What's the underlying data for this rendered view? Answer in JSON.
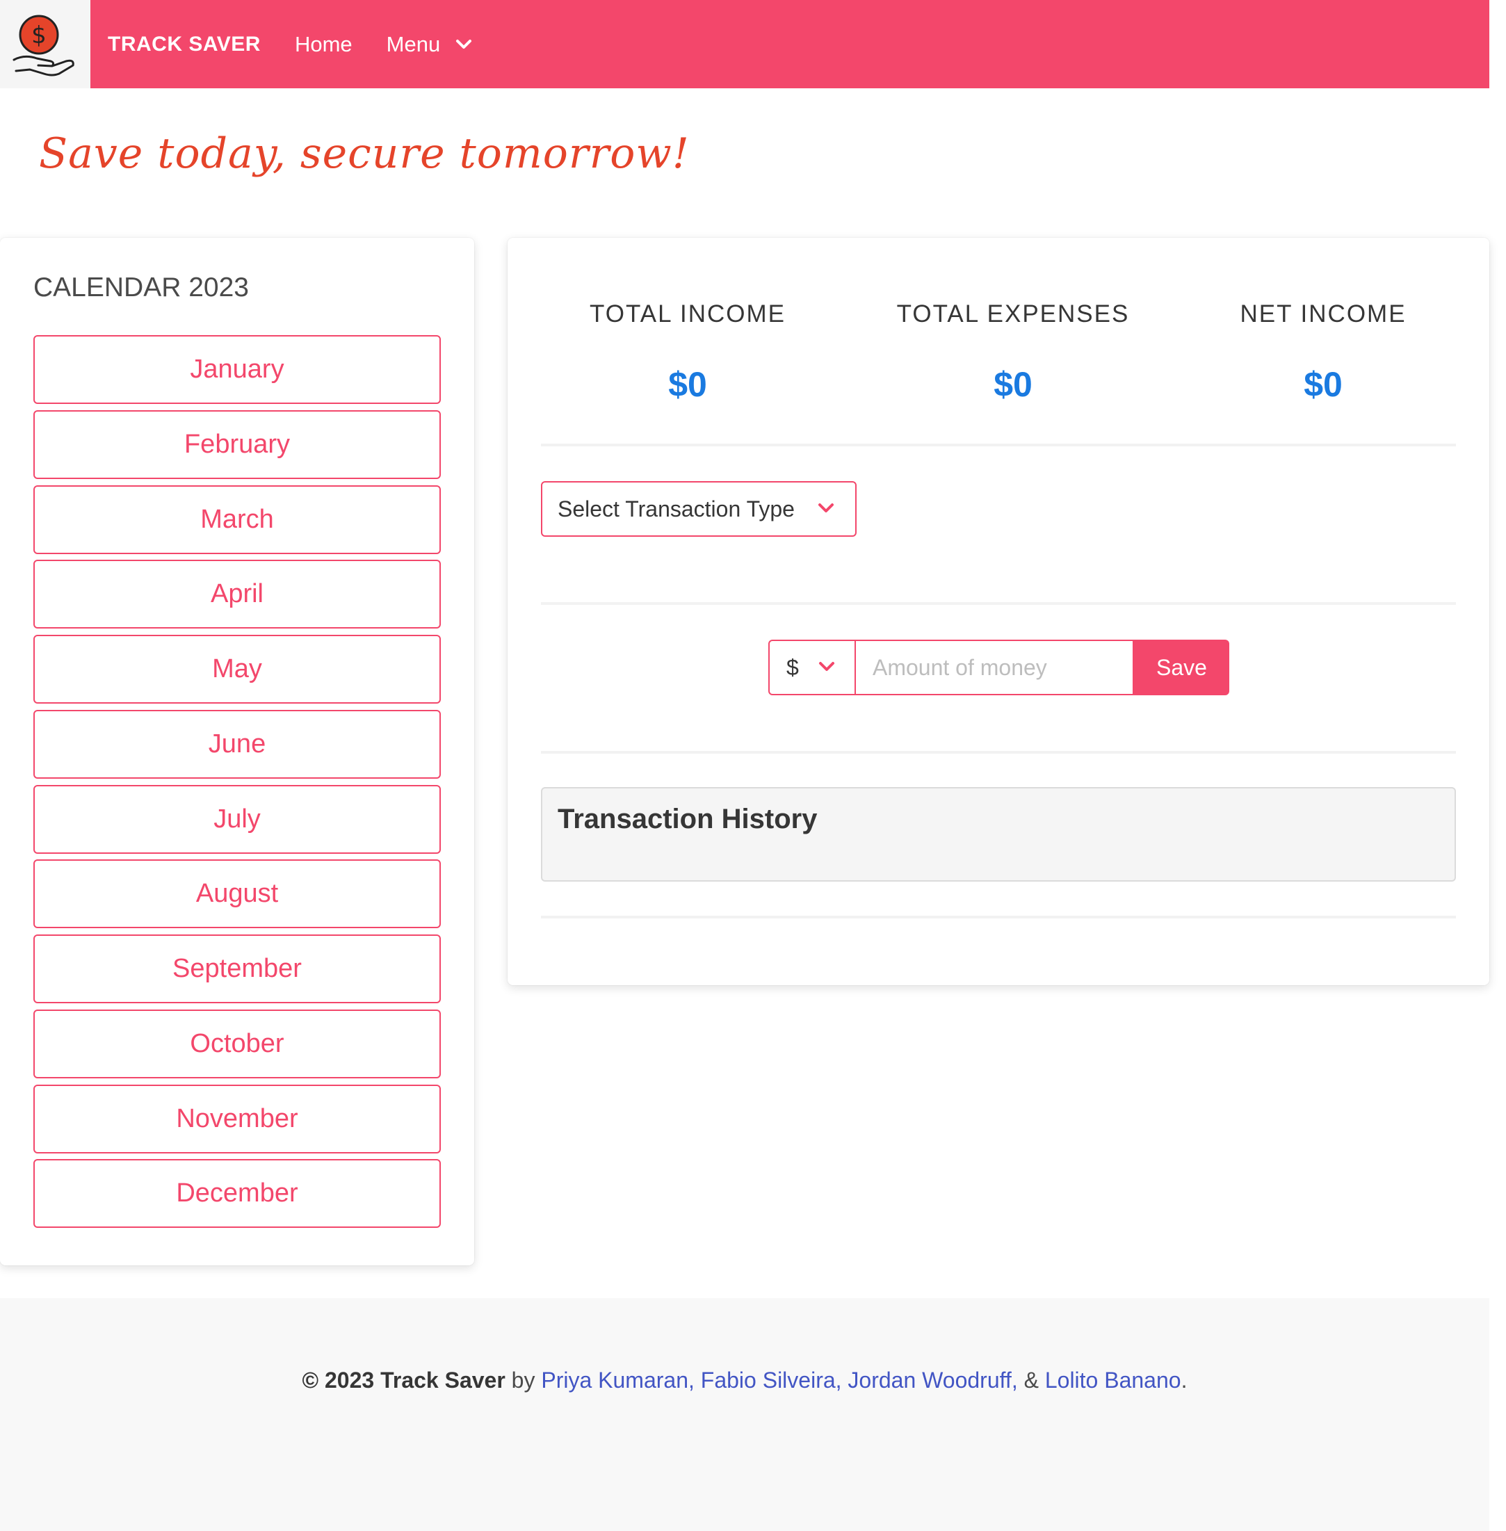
{
  "navbar": {
    "brand": "TRACK SAVER",
    "home": "Home",
    "menu": "Menu",
    "logo_icon": "dollar-hand-icon",
    "bg_color": "#f3476b"
  },
  "tagline": "Save today, secure tomorrow!",
  "calendar": {
    "title": "CALENDAR 2023",
    "months": [
      "January",
      "February",
      "March",
      "April",
      "May",
      "June",
      "July",
      "August",
      "September",
      "October",
      "November",
      "December"
    ]
  },
  "stats": {
    "income_label": "TOTAL INCOME",
    "income_value": "$0",
    "expenses_label": "TOTAL EXPENSES",
    "expenses_value": "$0",
    "net_label": "NET INCOME",
    "net_value": "$0"
  },
  "form": {
    "transaction_type": "Select Transaction Type",
    "currency": "$",
    "amount_placeholder": "Amount of money",
    "save": "Save"
  },
  "history": {
    "title": "Transaction History"
  },
  "footer": {
    "copyright": "© 2023 Track Saver",
    "by": "by",
    "authors": "Priya Kumaran, Fabio Silveira, Jordan Woodruff,",
    "amp": "&",
    "last_author": "Lolito Banano",
    "period": "."
  },
  "colors": {
    "accent": "#f3476b",
    "value_blue": "#1a7ae0",
    "tagline": "#e5442a",
    "link": "#4255c4"
  }
}
